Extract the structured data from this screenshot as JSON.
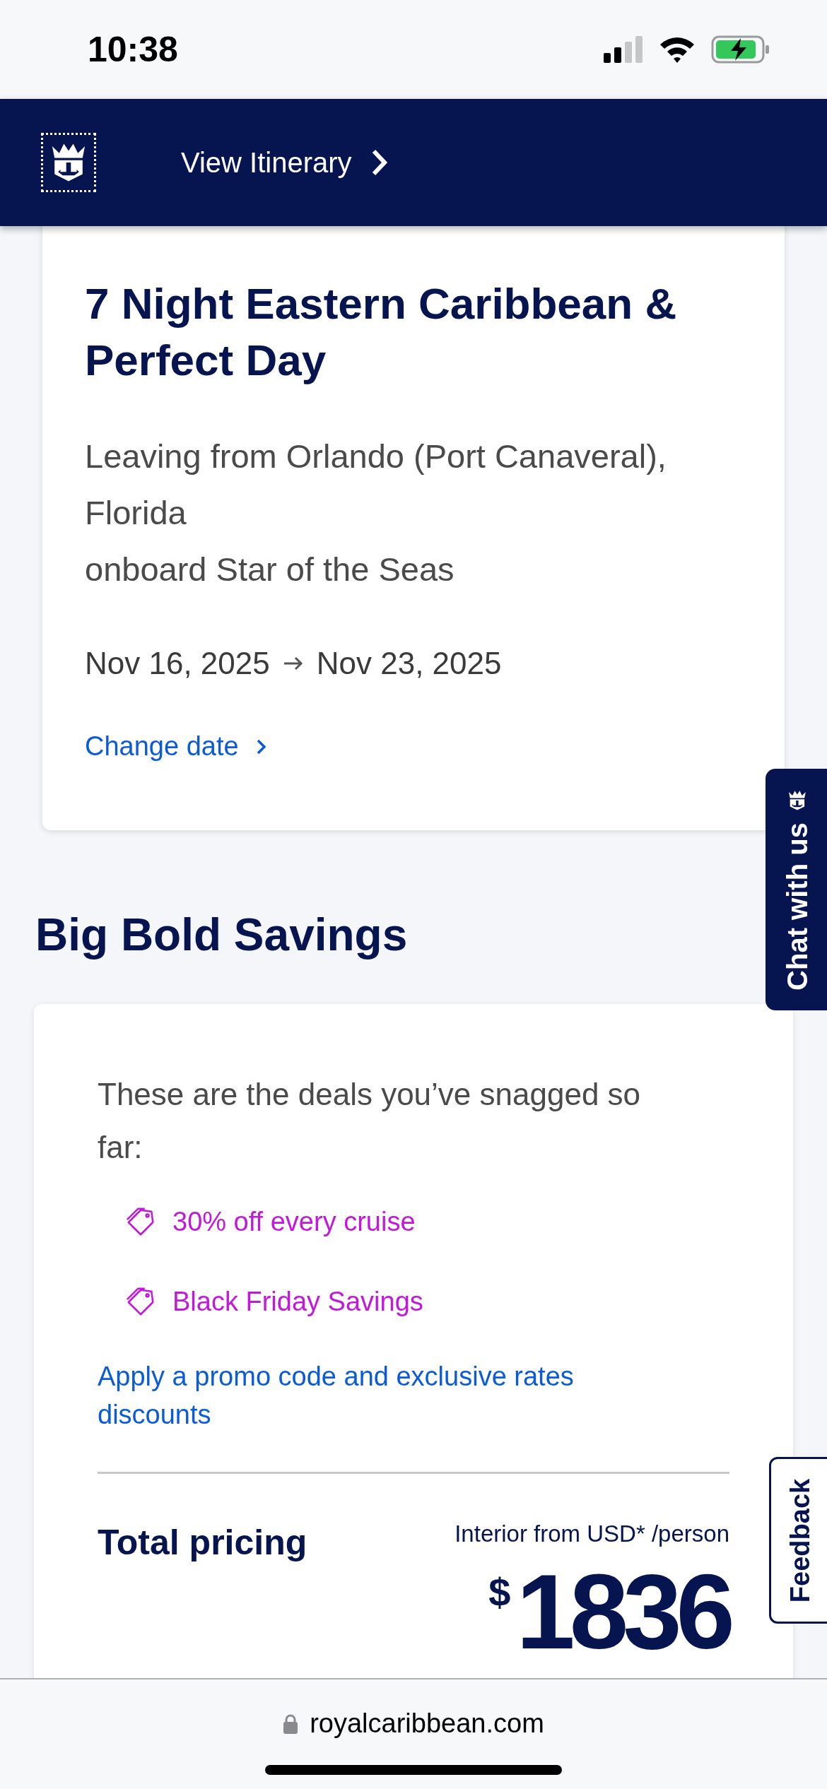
{
  "status_bar": {
    "time": "10:38"
  },
  "header": {
    "link": "View Itinerary"
  },
  "cruise": {
    "title": "7 Night Eastern Caribbean & Perfect Day",
    "departure": "Leaving from Orlando (Port Canaveral), Florida",
    "ship": "onboard Star of the Seas",
    "start_date": "Nov 16, 2025",
    "end_date": "Nov 23, 2025",
    "change_link": "Change date"
  },
  "savings": {
    "heading": "Big Bold Savings",
    "intro": "These are the deals you’ve snagged so far:",
    "deals": [
      {
        "label": "30% off every cruise"
      },
      {
        "label": "Black Friday Savings"
      }
    ],
    "promo_link": "Apply a promo code and exclusive rates discounts"
  },
  "pricing": {
    "title": "Total pricing",
    "note": "Interior from USD* /person",
    "currency": "$",
    "amount": "1836"
  },
  "chat_tab": "Chat with us",
  "feedback_tab": "Feedback",
  "browser": {
    "url": "royalcaribbean.com"
  }
}
